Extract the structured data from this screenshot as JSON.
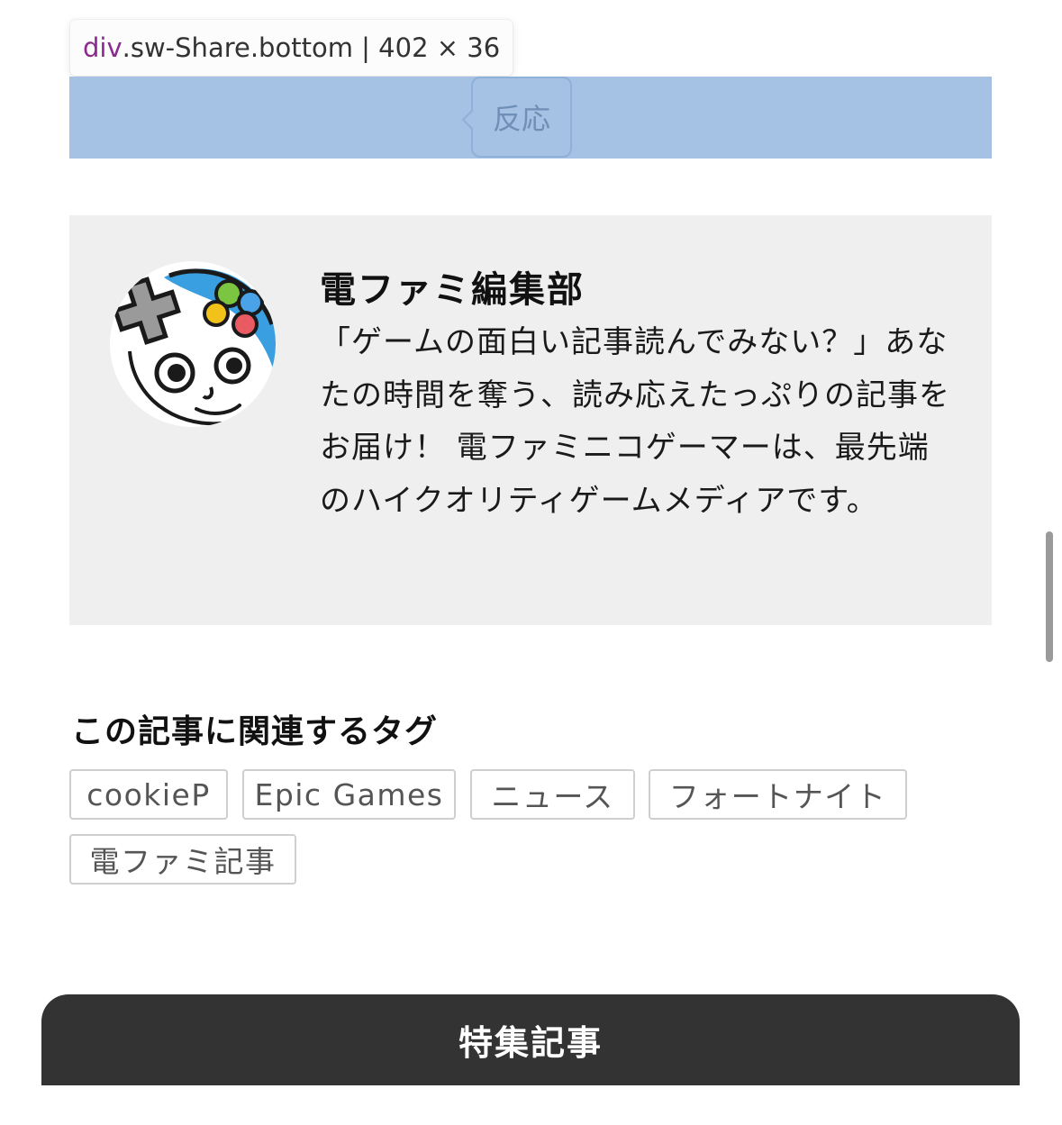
{
  "inspector": {
    "tag": "div",
    "class_name": ".sw-Share.bottom",
    "separator": "|",
    "dimensions": "402 × 36"
  },
  "share": {
    "reaction_label": "反応"
  },
  "author": {
    "name": "電ファミ編集部",
    "description": "「ゲームの面白い記事読んでみない？」あなたの時間を奪う、読み応えたっぷりの記事をお届け！ 電ファミニコゲーマーは、最先端のハイクオリティゲームメディアです。"
  },
  "tags": {
    "heading": "この記事に関連するタグ",
    "items": [
      {
        "label": "cookieP"
      },
      {
        "label": "Epic Games"
      },
      {
        "label": "ニュース"
      },
      {
        "label": "フォートナイト"
      },
      {
        "label": "電ファミ記事"
      }
    ]
  },
  "featured": {
    "label": "特集記事"
  },
  "colors": {
    "highlight": "#a5c1e3",
    "author_bg": "#efefef",
    "featured_bg": "#333333",
    "inspector_tag": "#8a2a8e"
  },
  "icons": {
    "avatar": "mascot-avatar-icon"
  }
}
